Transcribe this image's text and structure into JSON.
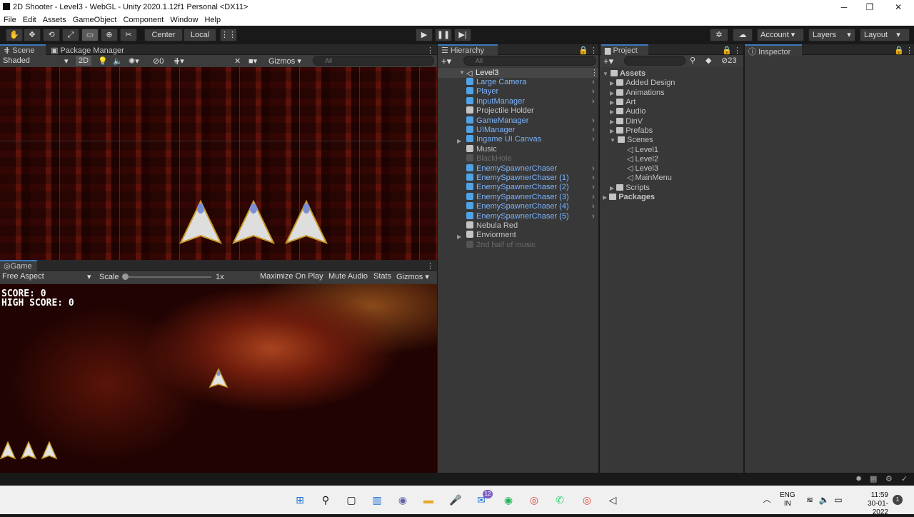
{
  "window": {
    "title": "2D Shooter - Level3 - WebGL - Unity 2020.1.12f1 Personal <DX11>"
  },
  "menu": [
    "File",
    "Edit",
    "Assets",
    "GameObject",
    "Component",
    "Window",
    "Help"
  ],
  "toolbar": {
    "center": "Center",
    "local": "Local",
    "account": "Account",
    "layers": "Layers",
    "layout": "Layout"
  },
  "scene": {
    "tabs": [
      "Scene",
      "Package Manager"
    ],
    "shading": "Shaded",
    "mode2d": "2D",
    "hidden_count": "0",
    "gizmos": "Gizmos",
    "search_placeholder": "All"
  },
  "game": {
    "tab": "Game",
    "aspect": "Free Aspect",
    "scale_label": "Scale",
    "scale_value": "1x",
    "maximize": "Maximize On Play",
    "mute": "Mute Audio",
    "stats": "Stats",
    "gizmos": "Gizmos",
    "score": "SCORE: 0",
    "high_score": "HIGH SCORE: 0"
  },
  "hierarchy": {
    "tab": "Hierarchy",
    "search_placeholder": "All",
    "root": "Level3",
    "items": [
      {
        "label": "Large Camera",
        "style": "blue",
        "arrow": true,
        "expander": false
      },
      {
        "label": "Player",
        "style": "blue",
        "arrow": true,
        "expander": false
      },
      {
        "label": "InputManager",
        "style": "blue",
        "arrow": true,
        "expander": false
      },
      {
        "label": "Projectile Holder",
        "style": "white",
        "arrow": false,
        "expander": false
      },
      {
        "label": "GameManager",
        "style": "blue",
        "arrow": true,
        "expander": false
      },
      {
        "label": "UIManager",
        "style": "blue",
        "arrow": true,
        "expander": false
      },
      {
        "label": "Ingame UI Canvas",
        "style": "blue",
        "arrow": true,
        "expander": true
      },
      {
        "label": "Music",
        "style": "white",
        "arrow": false,
        "expander": false
      },
      {
        "label": "BlackHole",
        "style": "gray",
        "arrow": false,
        "expander": false
      },
      {
        "label": "EnemySpawnerChaser",
        "style": "blue",
        "arrow": true,
        "expander": false
      },
      {
        "label": "EnemySpawnerChaser (1)",
        "style": "blue",
        "arrow": true,
        "expander": false
      },
      {
        "label": "EnemySpawnerChaser (2)",
        "style": "blue",
        "arrow": true,
        "expander": false
      },
      {
        "label": "EnemySpawnerChaser (3)",
        "style": "blue",
        "arrow": true,
        "expander": false
      },
      {
        "label": "EnemySpawnerChaser (4)",
        "style": "blue",
        "arrow": true,
        "expander": false
      },
      {
        "label": "EnemySpawnerChaser (5)",
        "style": "blue",
        "arrow": true,
        "expander": false
      },
      {
        "label": "Nebula Red",
        "style": "white",
        "arrow": false,
        "expander": false
      },
      {
        "label": "Enviorment",
        "style": "white",
        "arrow": false,
        "expander": true
      },
      {
        "label": "2nd half of music",
        "style": "gray",
        "arrow": false,
        "expander": false
      }
    ]
  },
  "project": {
    "tab": "Project",
    "hidden_count": "23",
    "root": "Assets",
    "folders": [
      "Added Design",
      "Animations",
      "Art",
      "Audio",
      "DinV",
      "Prefabs"
    ],
    "scenes_folder": "Scenes",
    "scenes": [
      "Level1",
      "Level2",
      "Level3",
      "MainMenu"
    ],
    "scripts_folder": "Scripts",
    "packages": "Packages"
  },
  "inspector": {
    "tab": "Inspector"
  },
  "taskbar": {
    "lang_line1": "ENG",
    "lang_line2": "IN",
    "time": "11:59",
    "date": "30-01-2022",
    "mail_badge": "12",
    "notif_badge": "1"
  },
  "colors": {
    "accent": "#3a79bb",
    "prefab_blue": "#7bb4ff",
    "panel": "#383838",
    "header": "#282828"
  }
}
